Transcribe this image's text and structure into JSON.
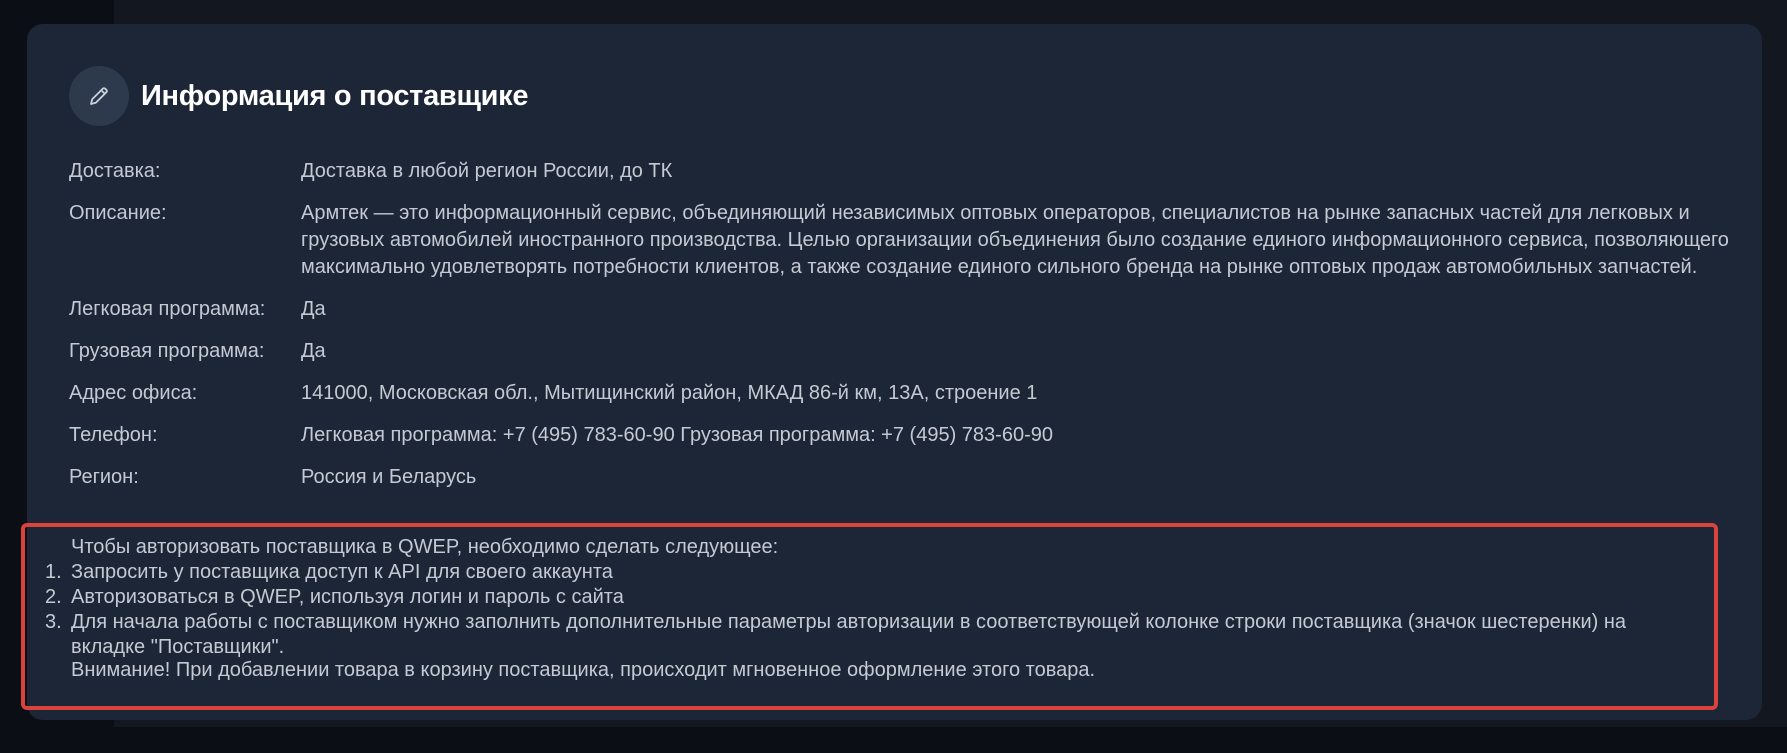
{
  "header": {
    "title": "Информация о поставщике",
    "edit_icon": "pencil-icon"
  },
  "fields": [
    {
      "label": "Доставка:",
      "value": "Доставка в любой регион России, до ТК"
    },
    {
      "label": "Описание:",
      "value": "Армтек — это информационный сервис, объединяющий независимых оптовых операторов, специалистов на рынке запасных частей для легковых и грузовых автомобилей иностранного производства. Целью организации объединения было создание единого информационного сервиса, позволяющего максимально удовлетворять потребности клиентов, а также создание единого сильного бренда на рынке оптовых продаж автомобильных запчастей."
    },
    {
      "label": "Легковая программа:",
      "value": "Да"
    },
    {
      "label": "Грузовая программа:",
      "value": "Да"
    },
    {
      "label": "Адрес офиса:",
      "value": "141000, Московская обл., Мытищинский район, МКАД 86-й км, 13А, строение 1"
    },
    {
      "label": "Телефон:",
      "value": "Легковая программа: +7 (495) 783-60-90 Грузовая программа: +7 (495) 783-60-90"
    },
    {
      "label": "Регион:",
      "value": "Россия и Беларусь"
    }
  ],
  "notice": {
    "intro": "Чтобы авторизовать поставщика в QWEP, необходимо сделать следующее:",
    "steps": [
      {
        "num": "1.",
        "text": "Запросить у поставщика доступ к API для своего аккаунта"
      },
      {
        "num": "2.",
        "text": "Авторизоваться в QWEP, используя логин и пароль с сайта"
      },
      {
        "num": "3.",
        "text": "Для начала работы с поставщиком нужно заполнить дополнительные параметры авторизации в соответствующей колонке строки поставщика (значок шестеренки) на вкладке \"Поставщики\"."
      }
    ],
    "warning": "Внимание! При добавлении товара в корзину поставщика, происходит мгновенное оформление этого товара."
  },
  "colors": {
    "page_background": "#121720",
    "card_background": "#1d2636",
    "icon_circle": "#2d394c",
    "highlight_border": "#d9433b",
    "text": "#c4cad3",
    "title": "#ffffff"
  }
}
